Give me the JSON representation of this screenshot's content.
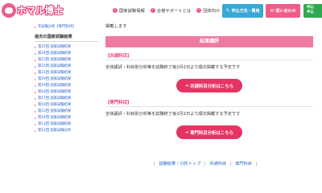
{
  "header": {
    "logo_text": "ホマル博士",
    "nav": [
      {
        "label": "国家試験情報"
      },
      {
        "label": "合格サポートとは"
      },
      {
        "label": "団体向け"
      }
    ],
    "apply_label": "申込方法・費用",
    "contact_label": "問い合わせ",
    "green_label_1": "申込",
    "green_label_2": "申込"
  },
  "sidebar": {
    "top_link": "年試験分析【専門科目】",
    "past_heading": "過去の国家試験結果",
    "past_links": [
      "第25回 国家試験結果",
      "第24回 国家試験結果",
      "第23回 国家試験結果",
      "第22回 国家試験結果",
      "第21回 国家試験結果",
      "第20回 国家試験結果",
      "第19回 国家試験結果",
      "第18回 国家試験結果",
      "第17回 国家試験結果",
      "第16回 国家試験結果",
      "第15回 国家試験結果",
      "第14回 国家試験結果",
      "第13回 国家試験結果",
      "第12回 国家試験分析"
    ]
  },
  "main": {
    "intro": "掲載します",
    "section_title": "結果講評",
    "common": {
      "heading": "【共通科目】",
      "text": "全体講評・科目別分析等を試験終了後2月2日より順次掲載する予定です",
      "button": "共通科目分析はこちら"
    },
    "specialized": {
      "heading": "【専門科目】",
      "text": "全体講評・科目別分析等を試験終了後2月2日より順次掲載する予定です",
      "button": "専門科目分析はこちら"
    },
    "footer": {
      "link1": "試験結果・分析トップ",
      "link2": "共通科目",
      "link3": "専門科目"
    }
  },
  "colors": {
    "brand_pink": "#ef5b8a",
    "cta_red": "#e63363",
    "apply_blue": "#39a8d6",
    "green": "#2fa84f",
    "link_blue": "#2563c9"
  }
}
